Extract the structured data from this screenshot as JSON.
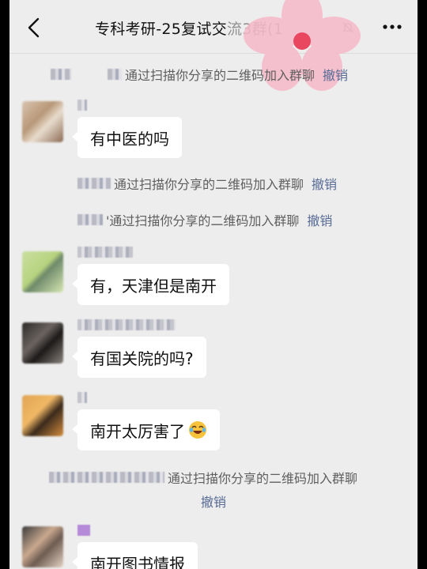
{
  "header": {
    "title_visible": "专科考研-25复试交",
    "title_obscured": "流3群(1",
    "back_icon": "chevron-left-icon",
    "mute_icon": "bell-off-icon",
    "more_icon": "ellipsis-icon"
  },
  "system_messages": [
    {
      "text": "通过扫描你分享的二维码加入群聊",
      "action": "撤销"
    },
    {
      "text": "通过扫描你分享的二维码加入群聊",
      "action": "撤销"
    },
    {
      "text": "'通过扫描你分享的二维码加入群聊",
      "action": "撤销"
    },
    {
      "text": "通过扫描你分享的二维码加入群聊",
      "action": "撤销"
    }
  ],
  "messages": [
    {
      "text": "有中医的吗"
    },
    {
      "text": "有，天津但是南开"
    },
    {
      "text": "有国关院的吗?"
    },
    {
      "text": "南开太厉害了",
      "emoji": "laughing-crying-face"
    },
    {
      "text": "南开图书情报"
    }
  ],
  "colors": {
    "background": "#ededed",
    "bubble": "#ffffff",
    "link": "#576b95",
    "system_text": "#5e5e5e"
  }
}
